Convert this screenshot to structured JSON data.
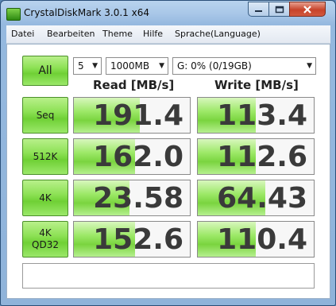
{
  "window": {
    "title": "CrystalDiskMark 3.0.1 x64"
  },
  "menu": [
    "Datei",
    "Bearbeiten",
    "Theme",
    "Hilfe",
    "Sprache(Language)"
  ],
  "controls": {
    "all_label": "All",
    "count_value": "5",
    "size_value": "1000MB",
    "drive_value": "G: 0% (0/19GB)"
  },
  "headers": {
    "read": "Read [MB/s]",
    "write": "Write [MB/s]"
  },
  "rows": [
    {
      "label": [
        "Seq"
      ],
      "read": "191.4",
      "write": "113.4",
      "read_level": 0.57,
      "write_level": 0.5
    },
    {
      "label": [
        "512K"
      ],
      "read": "162.0",
      "write": "112.6",
      "read_level": 0.53,
      "write_level": 0.5
    },
    {
      "label": [
        "4K"
      ],
      "read": "23.58",
      "write": "64.43",
      "read_level": 0.48,
      "write_level": 0.58
    },
    {
      "label": [
        "4K",
        "QD32"
      ],
      "read": "152.6",
      "write": "110.4",
      "read_level": 0.53,
      "write_level": 0.5
    }
  ],
  "status_text": ""
}
